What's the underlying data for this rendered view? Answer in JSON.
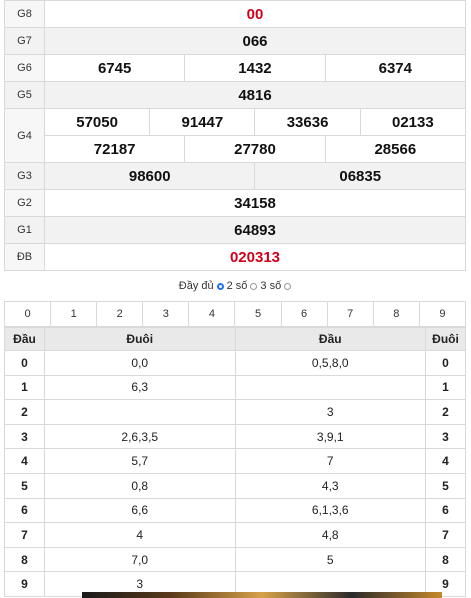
{
  "prizes": {
    "g8": {
      "label": "G8",
      "values": [
        "00"
      ]
    },
    "g7": {
      "label": "G7",
      "values": [
        "066"
      ]
    },
    "g6": {
      "label": "G6",
      "values": [
        "6745",
        "1432",
        "6374"
      ]
    },
    "g5": {
      "label": "G5",
      "values": [
        "4816"
      ]
    },
    "g4": {
      "label": "G4",
      "row1": [
        "57050",
        "91447",
        "33636",
        "02133"
      ],
      "row2": [
        "72187",
        "27780",
        "28566"
      ]
    },
    "g3": {
      "label": "G3",
      "values": [
        "98600",
        "06835"
      ]
    },
    "g2": {
      "label": "G2",
      "values": [
        "34158"
      ]
    },
    "g1": {
      "label": "G1",
      "values": [
        "64893"
      ]
    },
    "db": {
      "label": "ĐB",
      "values": [
        "020313"
      ]
    }
  },
  "options": {
    "full": "Đầy đủ",
    "two": "2 số",
    "three": "3 số",
    "selected": "two"
  },
  "digits": [
    "0",
    "1",
    "2",
    "3",
    "4",
    "5",
    "6",
    "7",
    "8",
    "9"
  ],
  "loto": {
    "headers": {
      "dau": "Đầu",
      "duoi": "Đuôi",
      "dau2": "Đầu",
      "duoi2": "Đuôi"
    },
    "rows": [
      {
        "left": "0",
        "duoi": "0,0",
        "dau": "0,5,8,0",
        "right": "0"
      },
      {
        "left": "1",
        "duoi": "6,3",
        "dau": "",
        "right": "1"
      },
      {
        "left": "2",
        "duoi": "",
        "dau": "3",
        "right": "2"
      },
      {
        "left": "3",
        "duoi": "2,6,3,5",
        "dau": "3,9,1",
        "right": "3"
      },
      {
        "left": "4",
        "duoi": "5,7",
        "dau": "7",
        "right": "4"
      },
      {
        "left": "5",
        "duoi": "0,8",
        "dau": "4,3",
        "right": "5"
      },
      {
        "left": "6",
        "duoi": "6,6",
        "dau": "6,1,3,6",
        "right": "6"
      },
      {
        "left": "7",
        "duoi": "4",
        "dau": "4,8",
        "right": "7"
      },
      {
        "left": "8",
        "duoi": "7,0",
        "dau": "5",
        "right": "8"
      },
      {
        "left": "9",
        "duoi": "3",
        "dau": "",
        "right": "9"
      }
    ]
  },
  "colors": {
    "highlight": "#d0021b",
    "radio": "#1e73e8"
  }
}
